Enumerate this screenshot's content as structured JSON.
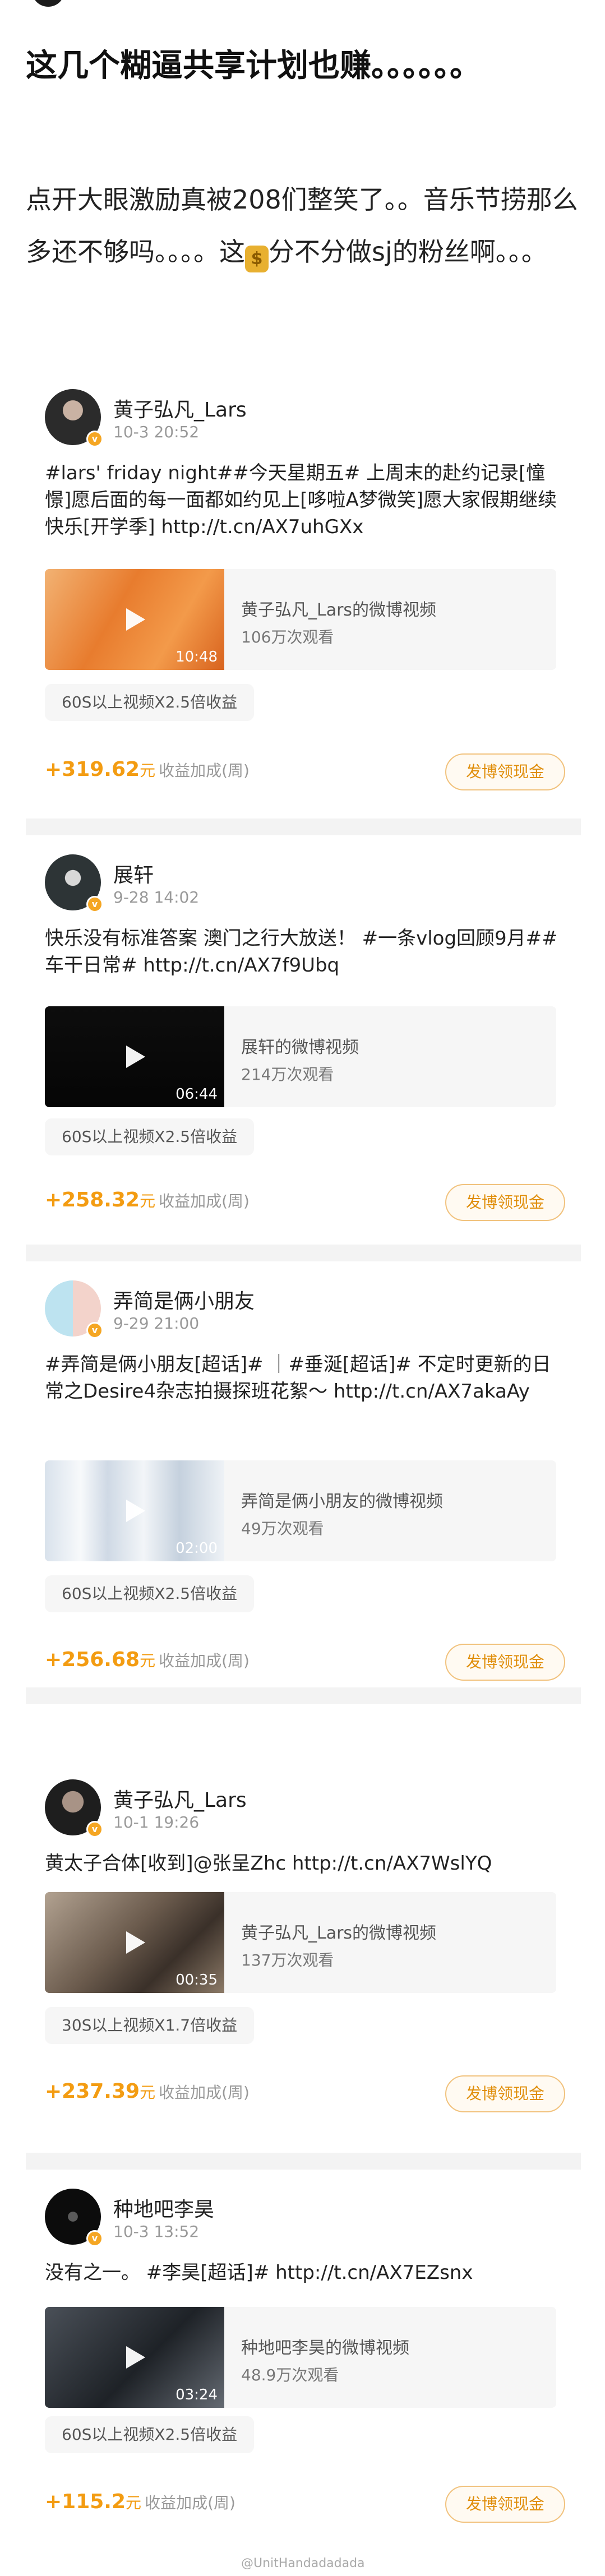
{
  "title": "这几个糊逼共享计划也赚。。。。。。",
  "intro": {
    "text_before": "点开大眼激励真被208们整笑了。。音乐节捞那么多还不够吗。。。。这",
    "coin_glyph": "$",
    "text_after": "分不分做sj的粉丝啊。。。"
  },
  "posts": [
    {
      "user": "黄子弘凡_Lars",
      "time": "10-3 20:52",
      "text": "#lars' friday night##今天星期五# 上周末的赴约记录[憧憬]愿后面的每一面都如约见上[哆啦A梦微笑]愿大家假期继续快乐[开学季] http://t.cn/AX7uhGXx",
      "video_title": "黄子弘凡_Lars的微博视频",
      "video_views": "106万次观看",
      "duration": "10:48",
      "reward": "60S以上视频X2.5倍收益",
      "amount": "+319.62",
      "unit": "元",
      "label": "收益加成(周)",
      "button": "发博领现金"
    },
    {
      "user": "展轩",
      "time": "9-28 14:02",
      "text": "快乐没有标准答案 澳门之行大放送！ #一条vlog回顾9月##车干日常# http://t.cn/AX7f9Ubq",
      "video_title": "展轩的微博视频",
      "video_views": "214万次观看",
      "duration": "06:44",
      "reward": "60S以上视频X2.5倍收益",
      "amount": "+258.32",
      "unit": "元",
      "label": "收益加成(周)",
      "button": "发博领现金"
    },
    {
      "user": "弄简是俩小朋友",
      "time": "9-29 21:00",
      "text": "#弄简是俩小朋友[超话]# ｜#垂涎[超话]# 不定时更新的日常之Desire4杂志拍摄探班花絮～ http://t.cn/AX7akaAy",
      "video_title": "弄简是俩小朋友的微博视频",
      "video_views": "49万次观看",
      "duration": "02:00",
      "reward": "60S以上视频X2.5倍收益",
      "amount": "+256.68",
      "unit": "元",
      "label": "收益加成(周)",
      "button": "发博领现金"
    },
    {
      "user": "黄子弘凡_Lars",
      "time": "10-1 19:26",
      "text": "黄太子合体[收到]@张呈Zhc http://t.cn/AX7WslYQ",
      "video_title": "黄子弘凡_Lars的微博视频",
      "video_views": "137万次观看",
      "duration": "00:35",
      "reward": "30S以上视频X1.7倍收益",
      "amount": "+237.39",
      "unit": "元",
      "label": "收益加成(周)",
      "button": "发博领现金"
    },
    {
      "user": "种地吧李昊",
      "time": "10-3 13:52",
      "text": "没有之一。 #李昊[超话]# http://t.cn/AX7EZsnx",
      "video_title": "种地吧李昊的微博视频",
      "video_views": "48.9万次观看",
      "duration": "03:24",
      "reward": "60S以上视频X2.5倍收益",
      "amount": "+115.2",
      "unit": "元",
      "label": "收益加成(周)",
      "button": "发博领现金"
    }
  ],
  "verified_badge": "v",
  "watermark": "@UnitHandadadada",
  "colors": {
    "accent": "#f39c12",
    "button_border": "#f1c27d",
    "background": "#ffffff",
    "divider": "#f3f3f3"
  }
}
